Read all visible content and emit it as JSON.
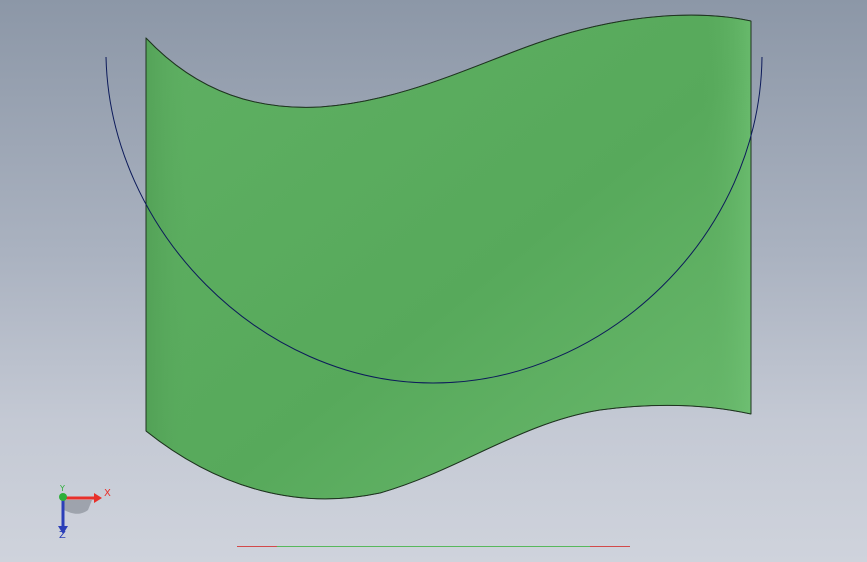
{
  "view": {
    "background_top": "#8c97a7",
    "background_bottom": "#cfd3dc"
  },
  "model": {
    "face_color": "#5aad5e",
    "edge_color": "#1f3420",
    "sketch_color": "#0c1a5a"
  },
  "triad": {
    "x_label": "X",
    "y_label": "Y",
    "z_label": "Z",
    "x_color": "#e8302a",
    "y_color": "#2fae3a",
    "z_color": "#2b3fb8"
  },
  "status_strip": {
    "colors": [
      "#d24a4a",
      "#58b85c",
      "#d24a4a"
    ]
  }
}
